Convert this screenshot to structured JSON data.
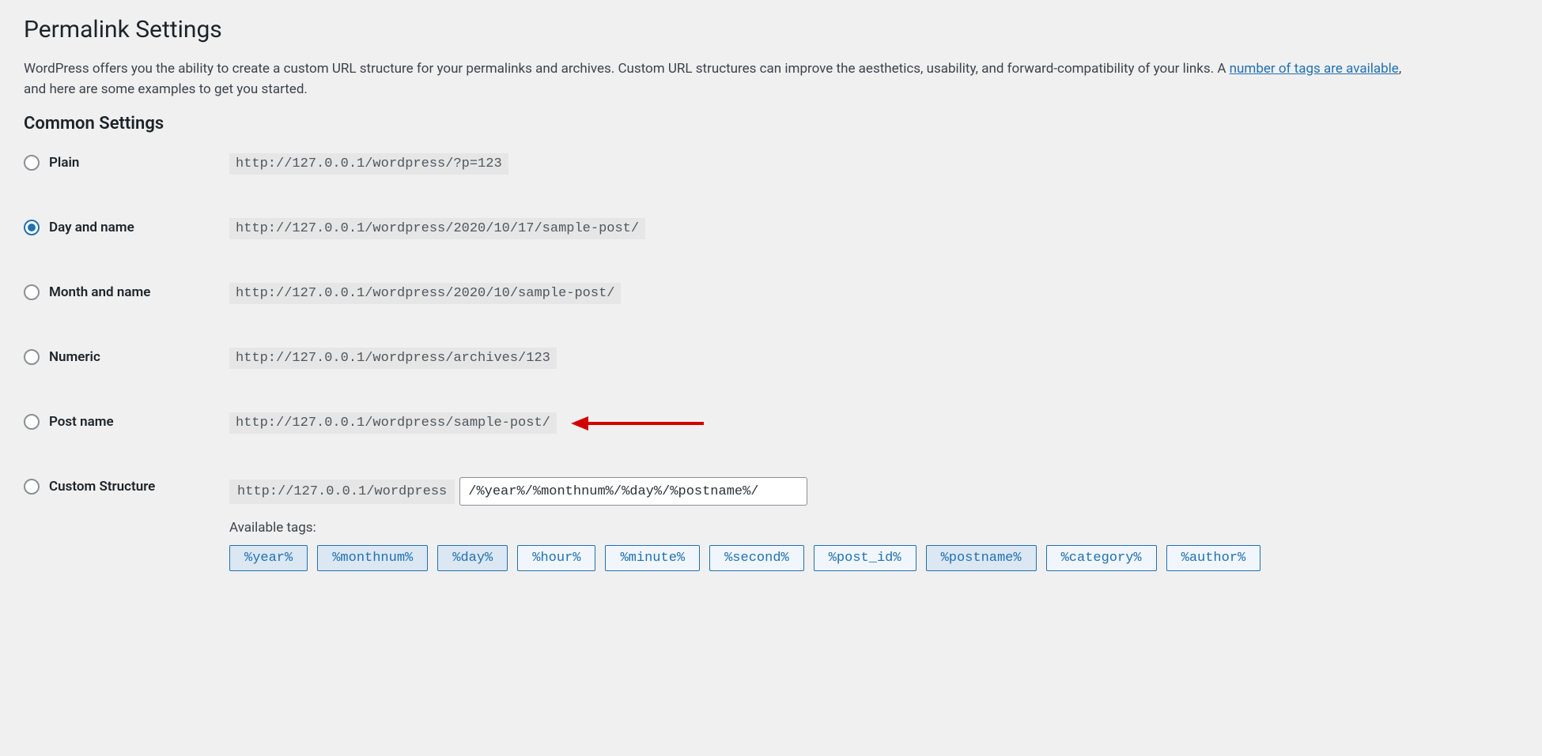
{
  "page": {
    "title": "Permalink Settings",
    "description_pre": "WordPress offers you the ability to create a custom URL structure for your permalinks and archives. Custom URL structures can improve the aesthetics, usability, and forward-compatibility of your links. A ",
    "description_link": "number of tags are available",
    "description_post": ", and here are some examples to get you started."
  },
  "common_settings": {
    "heading": "Common Settings",
    "options": [
      {
        "key": "plain",
        "label": "Plain",
        "example": "http://127.0.0.1/wordpress/?p=123",
        "checked": false
      },
      {
        "key": "day-and-name",
        "label": "Day and name",
        "example": "http://127.0.0.1/wordpress/2020/10/17/sample-post/",
        "checked": true
      },
      {
        "key": "month-and-name",
        "label": "Month and name",
        "example": "http://127.0.0.1/wordpress/2020/10/sample-post/",
        "checked": false
      },
      {
        "key": "numeric",
        "label": "Numeric",
        "example": "http://127.0.0.1/wordpress/archives/123",
        "checked": false
      },
      {
        "key": "post-name",
        "label": "Post name",
        "example": "http://127.0.0.1/wordpress/sample-post/",
        "checked": false
      }
    ],
    "custom": {
      "label": "Custom Structure",
      "prefix": "http://127.0.0.1/wordpress",
      "value": "/%year%/%monthnum%/%day%/%postname%/",
      "checked": false,
      "available_tags_label": "Available tags:",
      "tags": [
        {
          "text": "%year%",
          "selected": true
        },
        {
          "text": "%monthnum%",
          "selected": true
        },
        {
          "text": "%day%",
          "selected": true
        },
        {
          "text": "%hour%",
          "selected": false
        },
        {
          "text": "%minute%",
          "selected": false
        },
        {
          "text": "%second%",
          "selected": false
        },
        {
          "text": "%post_id%",
          "selected": false
        },
        {
          "text": "%postname%",
          "selected": true
        },
        {
          "text": "%category%",
          "selected": false
        },
        {
          "text": "%author%",
          "selected": false
        }
      ]
    }
  },
  "annotation": {
    "arrow_color": "#d40000",
    "points_to": "post-name"
  }
}
